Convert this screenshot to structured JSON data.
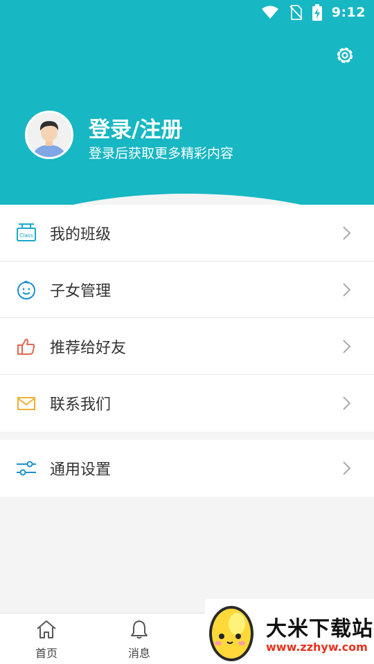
{
  "status_bar": {
    "time": "9:12",
    "icons": [
      "wifi-icon",
      "no-sim-icon",
      "battery-charging-icon"
    ]
  },
  "header": {
    "settings_icon": "gear-icon",
    "title": "登录/注册",
    "subtitle": "登录后获取更多精彩内容",
    "accent_color": "#17b7c3"
  },
  "menu": {
    "items": [
      {
        "label": "我的班级",
        "icon": "class-sign-icon"
      },
      {
        "label": "子女管理",
        "icon": "baby-face-icon"
      },
      {
        "label": "推荐给好友",
        "icon": "thumbs-up-icon"
      },
      {
        "label": "联系我们",
        "icon": "mail-icon"
      }
    ],
    "settings_item": {
      "label": "通用设置",
      "icon": "sliders-icon"
    }
  },
  "bottom_nav": {
    "items": [
      {
        "label": "首页",
        "icon": "home-icon"
      },
      {
        "label": "消息",
        "icon": "bell-icon"
      }
    ]
  },
  "watermark": {
    "title": "大米下载站",
    "url": "www.zzhyw.com"
  }
}
